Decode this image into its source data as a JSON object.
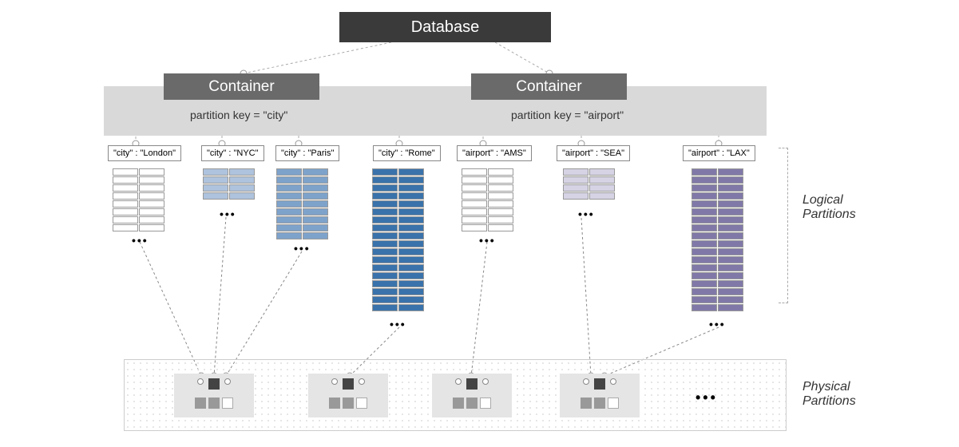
{
  "database": {
    "label": "Database"
  },
  "containers": {
    "left": {
      "label": "Container",
      "partitionKey": "partition key = \"city\""
    },
    "right": {
      "label": "Container",
      "partitionKey": "partition key = \"airport\""
    }
  },
  "partitions": {
    "city_london": "\"city\" : \"London\"",
    "city_nyc": "\"city\" : \"NYC\"",
    "city_paris": "\"city\" : \"Paris\"",
    "city_rome": "\"city\" : \"Rome\"",
    "airport_ams": "\"airport\" : \"AMS\"",
    "airport_sea": "\"airport\" : \"SEA\"",
    "airport_lax": "\"airport\" : \"LAX\""
  },
  "labels": {
    "logical": "Logical\nPartitions",
    "physical": "Physical\nPartitions"
  },
  "dots": "•••"
}
